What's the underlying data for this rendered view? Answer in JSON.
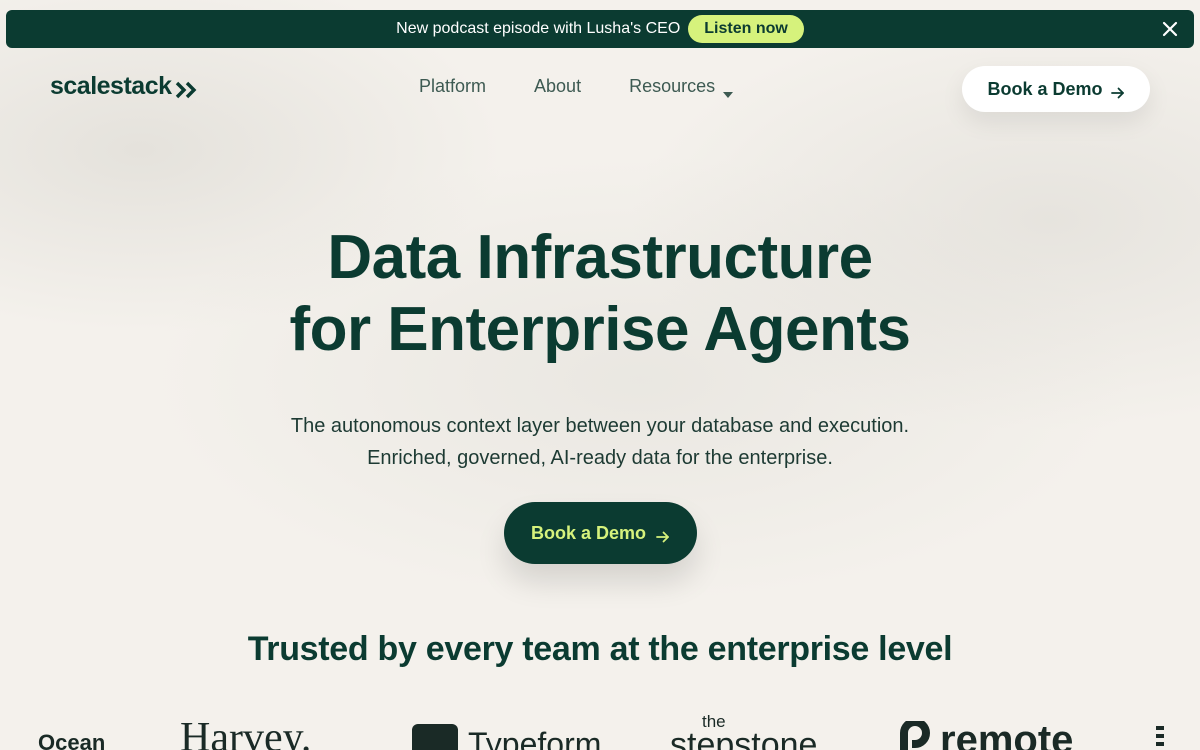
{
  "announcement": {
    "text": "New podcast episode with Lusha's CEO",
    "cta": "Listen now",
    "close_icon": "close-icon"
  },
  "header": {
    "logo_text": "scalestack",
    "logo_icon": "double-chevron-right-icon",
    "nav": [
      {
        "label": "Platform"
      },
      {
        "label": "About"
      },
      {
        "label": "Resources",
        "icon": "caret-down-icon"
      }
    ],
    "demo_button": "Book a Demo",
    "demo_icon": "arrow-right-icon"
  },
  "hero": {
    "title_line1": "Data Infrastructure",
    "title_line2": "for Enterprise Agents",
    "subtitle_line1": "The autonomous context layer between your database and execution.",
    "subtitle_line2": "Enriched, governed, AI-ready data for the enterprise.",
    "cta": "Book a Demo"
  },
  "trusted": {
    "heading": "Trusted by every team at the enterprise level",
    "logos": [
      {
        "name": "Ocean"
      },
      {
        "name": "Harvey."
      },
      {
        "name": "Typeform"
      },
      {
        "name": "the stepstone",
        "top": "the",
        "main": "stepstone"
      },
      {
        "name": "remote"
      }
    ]
  },
  "colors": {
    "brand_dark": "#0b3b31",
    "accent_lime": "#d6f27c",
    "background": "#f4f1ec"
  }
}
